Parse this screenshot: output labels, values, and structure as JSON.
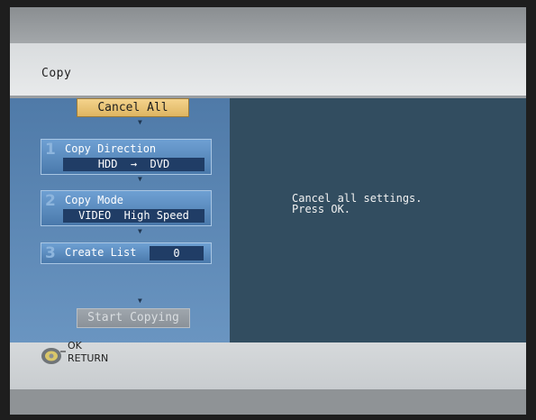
{
  "window": {
    "title": "Copy"
  },
  "buttons": {
    "cancel_all": "Cancel All",
    "start_copying": "Start Copying"
  },
  "steps": [
    {
      "number": "1",
      "label": "Copy Direction",
      "value": "HDD  →  DVD"
    },
    {
      "number": "2",
      "label": "Copy Mode",
      "value": "VIDEO  High Speed"
    },
    {
      "number": "3",
      "label": "Create List",
      "value": "0"
    }
  ],
  "message": {
    "line1": "Cancel all settings.",
    "line2": "Press OK."
  },
  "hints": {
    "ok": "OK",
    "return": "RETURN",
    "icon": "remote-dial-icon"
  },
  "arrow_glyph": "▼",
  "colors": {
    "highlight": "#deb561",
    "panel": "#5a86b4",
    "info_panel": "#324d60",
    "disabled": "#8a9199"
  }
}
